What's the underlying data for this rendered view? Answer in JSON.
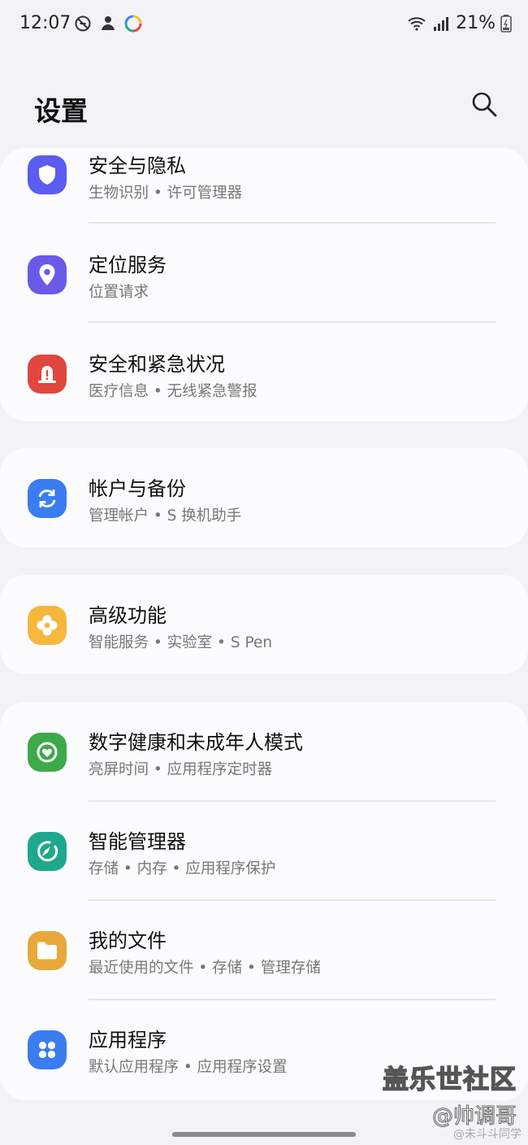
{
  "status_bar": {
    "time": "12:07",
    "battery": "21%"
  },
  "header": {
    "title": "设置"
  },
  "items": [
    {
      "title": "安全与隐私",
      "subtitle": "生物识别 • 许可管理器",
      "icon": "shield-icon",
      "color": "#5b5cf0"
    },
    {
      "title": "定位服务",
      "subtitle": "位置请求",
      "icon": "location-pin-icon",
      "color": "#6a5ae8"
    },
    {
      "title": "安全和紧急状况",
      "subtitle": "医疗信息 • 无线紧急警报",
      "icon": "emergency-alert-icon",
      "color": "#e0473e"
    },
    {
      "title": "帐户与备份",
      "subtitle": "管理帐户 • S 换机助手",
      "icon": "sync-icon",
      "color": "#3b7cf0"
    },
    {
      "title": "高级功能",
      "subtitle": "智能服务 • 实验室 • S Pen",
      "icon": "advanced-features-icon",
      "color": "#f6b73c"
    },
    {
      "title": "数字健康和未成年人模式",
      "subtitle": "亮屏时间 • 应用程序定时器",
      "icon": "digital-wellbeing-icon",
      "color": "#3daa4a"
    },
    {
      "title": "智能管理器",
      "subtitle": "存储 • 内存 • 应用程序保护",
      "icon": "device-care-icon",
      "color": "#1ea88d"
    },
    {
      "title": "我的文件",
      "subtitle": "最近使用的文件 • 存储 • 管理存储",
      "icon": "folder-icon",
      "color": "#e8a93a"
    },
    {
      "title": "应用程序",
      "subtitle": "默认应用程序 • 应用程序设置",
      "icon": "apps-icon",
      "color": "#3b7cf0"
    }
  ],
  "watermark": {
    "line1": "盖乐世社区",
    "line2": "@帅调哥",
    "line3": "@未斗斗同学"
  }
}
